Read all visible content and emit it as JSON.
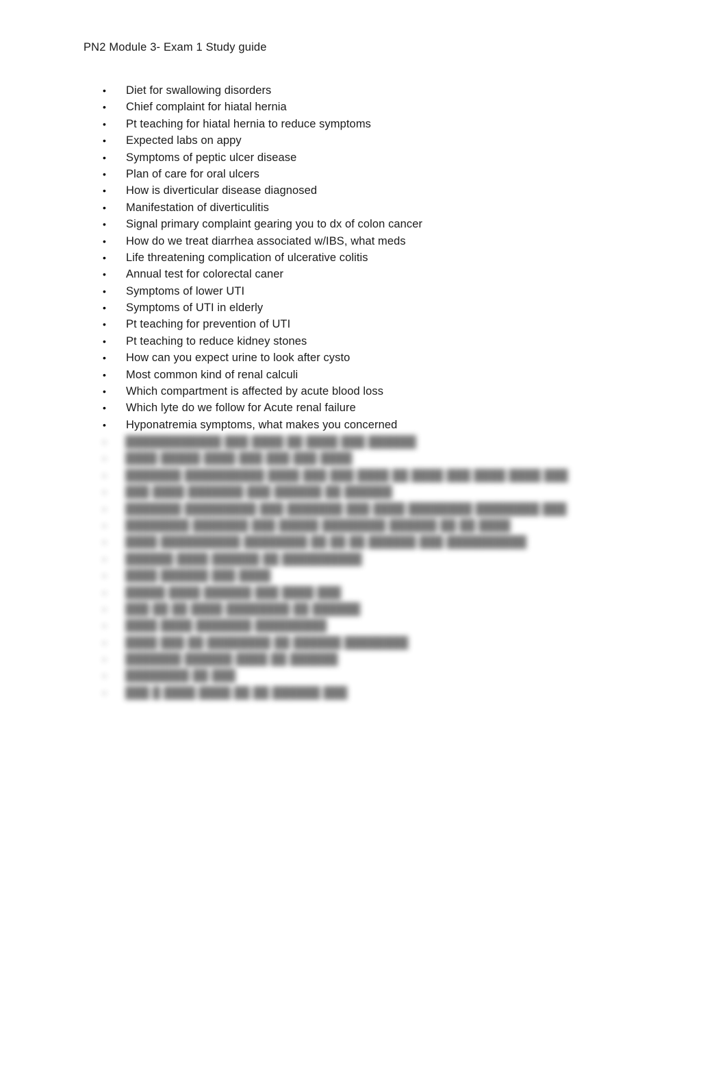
{
  "document": {
    "title": "PN2 Module 3- Exam 1 Study guide",
    "background_color": "#ffffff",
    "text_color": "#1a1a1a"
  },
  "study_guide": {
    "bullet_glyph": "•",
    "items": [
      {
        "label": "Diet for swallowing disorders"
      },
      {
        "label": "Chief complaint for hiatal hernia"
      },
      {
        "label": "Pt teaching for hiatal hernia to reduce symptoms"
      },
      {
        "label": "Expected labs on appy"
      },
      {
        "label": "Symptoms of peptic ulcer disease"
      },
      {
        "label": "Plan of care for oral ulcers"
      },
      {
        "label": "How is diverticular disease diagnosed"
      },
      {
        "label": "Manifestation of diverticulitis"
      },
      {
        "label": "Signal primary complaint gearing you to dx of colon cancer"
      },
      {
        "label": "How do we treat diarrhea associated w/IBS, what meds"
      },
      {
        "label": "Life threatening complication of ulcerative colitis"
      },
      {
        "label": "Annual test for colorectal caner"
      },
      {
        "label": "Symptoms of lower UTI"
      },
      {
        "label": "Symptoms of UTI in elderly"
      },
      {
        "label": "Pt teaching for prevention of UTI"
      },
      {
        "label": "Pt teaching to reduce kidney stones"
      },
      {
        "label": "How can you expect urine to look after cysto"
      },
      {
        "label": "Most common kind of renal calculi"
      },
      {
        "label": "Which compartment is affected by acute blood loss"
      },
      {
        "label": "Which lyte do we follow for Acute renal failure"
      },
      {
        "label": "Hyponatremia symptoms, what makes you concerned"
      }
    ]
  },
  "obscured_section": {
    "note": "Remaining list items are blurred and illegible in the screenshot",
    "bullet_glyph": "•",
    "lines": [
      {
        "placeholder": "████████████ ███ ████ ██ ████ ███ ██████"
      },
      {
        "placeholder": "████ █████ ████ ███ ███ ███ ████"
      },
      {
        "placeholder": "███████ ██████████ ████ ███ ███ ████ ██ ████ ███ ████ ████ ███"
      },
      {
        "placeholder": "███ ████ ███████ ███ ██████ ██ ██████"
      },
      {
        "placeholder": "███████ █████████ ███ ███████ ███ ████ ████████ ████████ ███"
      },
      {
        "placeholder": "████████ ███████ ███ █████ ████████ ██████ ██ ██ ████"
      },
      {
        "placeholder": "████ ██████████ ████████ ██ ██ ██ ██████ ███ ██████████"
      },
      {
        "placeholder": "██████ ████ ██████ ██ ██████████"
      },
      {
        "placeholder": "████ ██████ ███ ████"
      },
      {
        "placeholder": "█████ ████ ██████ ███ ████ ███"
      },
      {
        "placeholder": "███ ██ ██ ████ ████████ ██ ██████"
      },
      {
        "placeholder": "████ ████ ███████ █████████"
      },
      {
        "placeholder": "████ ███ ██ ████████ ██ ██████ ████████"
      },
      {
        "placeholder": "███████ ██████ ████ ██ ██████"
      },
      {
        "placeholder": "████████ ██ ███"
      },
      {
        "placeholder": "███ █ ████ ████ ██ ██ ██████ ███"
      }
    ]
  }
}
